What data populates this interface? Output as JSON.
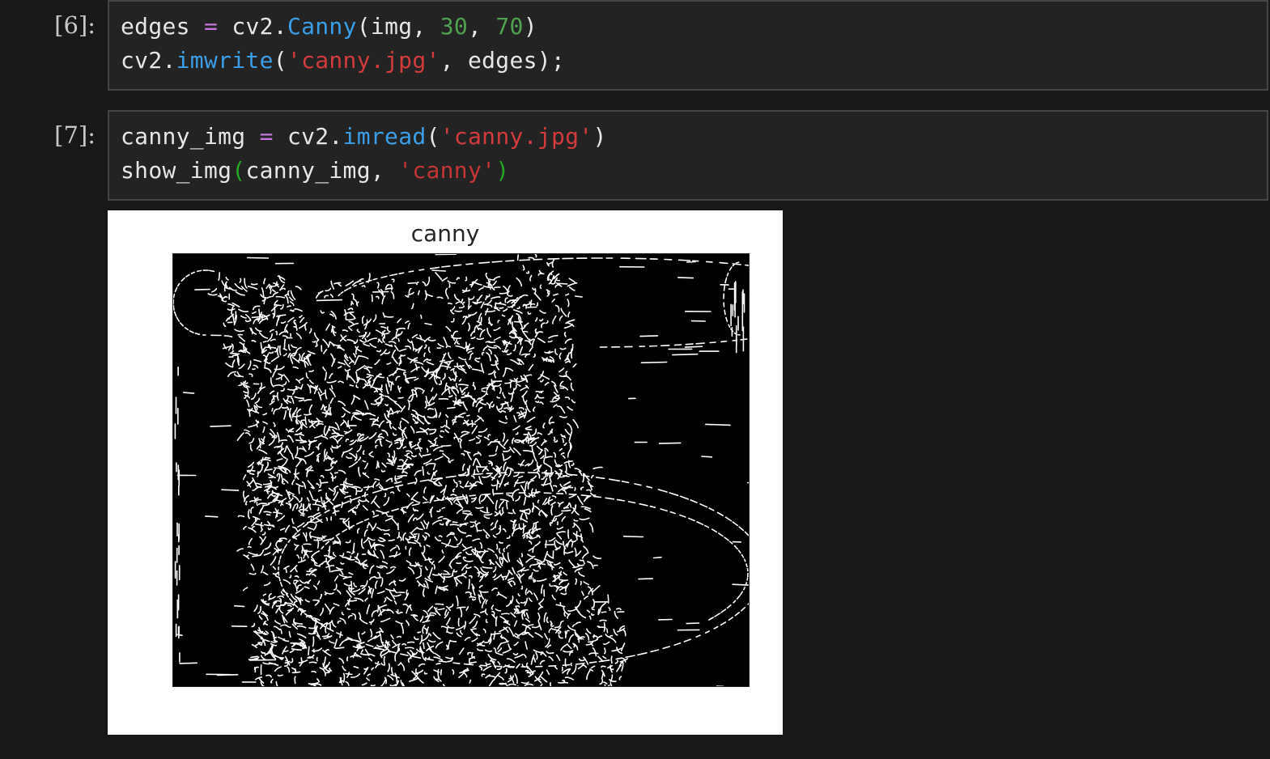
{
  "cells": [
    {
      "prompt": "[6]:",
      "lines": [
        [
          "edges",
          " ",
          "=",
          " ",
          "cv2.",
          "Canny",
          "(img, ",
          "30",
          ", ",
          "70",
          ")"
        ],
        [
          "cv2.",
          "imwrite",
          "(",
          "'canny.jpg'",
          ", edges);"
        ]
      ]
    },
    {
      "prompt": "[7]:",
      "lines": [
        [
          "canny_img",
          " ",
          "=",
          " ",
          "cv2.",
          "imread",
          "(",
          "'canny.jpg'",
          ")"
        ],
        [
          "show_img",
          "(",
          "canny_img, ",
          "'canny'",
          ")"
        ]
      ]
    }
  ],
  "output": {
    "title": "canny",
    "image_description_icon": "canny-edge-image"
  },
  "colors": {
    "background": "#181818",
    "editor": "#232323",
    "operator": "#c678dd",
    "function": "#3b9ee8",
    "number": "#4fa14f",
    "string": "#d23b3b"
  }
}
